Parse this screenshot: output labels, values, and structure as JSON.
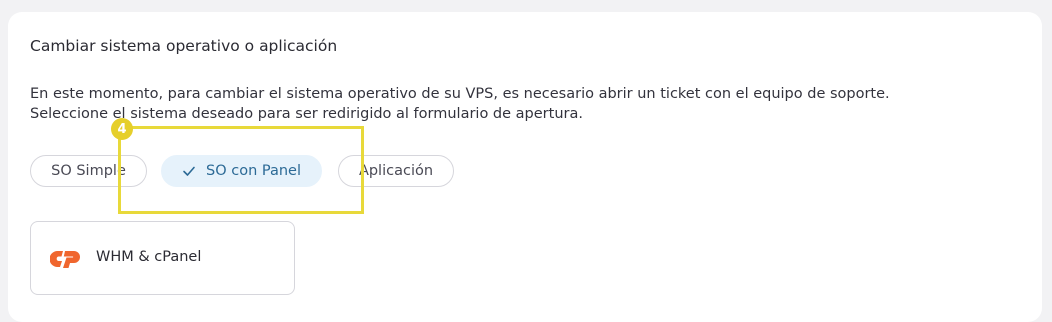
{
  "section": {
    "title": "Cambiar sistema operativo o aplicación",
    "description_line1": "En este momento, para cambiar el sistema operativo de su VPS, es necesario abrir un ticket con el equipo de soporte.",
    "description_line2": "Seleccione el sistema deseado para ser redirigido al formulario de apertura."
  },
  "tabs": [
    {
      "label": "SO Simple",
      "selected": false
    },
    {
      "label": "SO con Panel",
      "selected": true
    },
    {
      "label": "Aplicación",
      "selected": false
    }
  ],
  "annotation": {
    "step_number": "4",
    "color": "#e8d93a"
  },
  "options": [
    {
      "label": "WHM & cPanel",
      "icon": "cpanel-logo-icon",
      "icon_color": "#f0662e"
    }
  ],
  "colors": {
    "selected_bg": "#e6f2fb",
    "selected_text": "#2c6a96",
    "border": "#d6d6dc"
  }
}
